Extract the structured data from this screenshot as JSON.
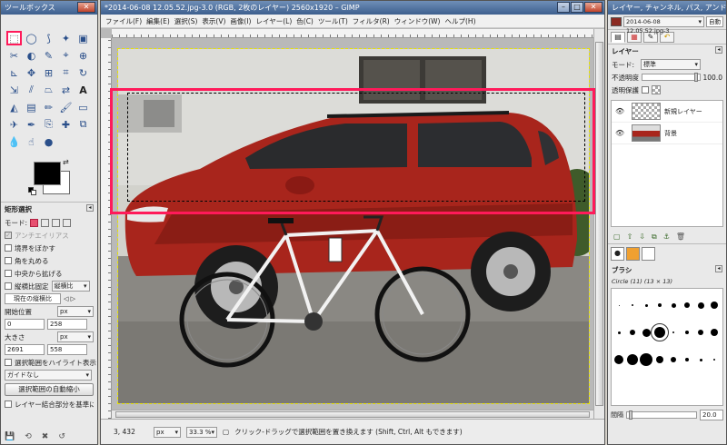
{
  "toolbox": {
    "title": "ツールボックス",
    "tool_options_title": "矩形選択",
    "mode_label": "モード:",
    "antialias_label": "アンチエイリアス",
    "feather_label": "境界をぼかす",
    "round_label": "角を丸める",
    "expand_center_label": "中央から拡げる",
    "fixed_label": "縦横比固定",
    "fixed_option": "縦横比",
    "ratio_value": "現在の縦横比",
    "position_label": "開始位置",
    "position_unit": "px",
    "position_x": "0",
    "position_y": "258",
    "size_label": "大きさ",
    "size_unit": "px",
    "size_w": "2691",
    "size_h": "558",
    "highlight_label": "選択範囲をハイライト表示",
    "guide_value": "ガイドなし",
    "autoshrink_label": "選択範囲の自動縮小",
    "merged_label": "レイヤー結合部分を基準に縮小"
  },
  "image_window": {
    "title": "*2014-06-08 12.05.52.jpg-3.0 (RGB, 2枚のレイヤー) 2560x1920 – GIMP",
    "menu": [
      "ファイル(F)",
      "編集(E)",
      "選択(S)",
      "表示(V)",
      "画像(I)",
      "レイヤー(L)",
      "色(C)",
      "ツール(T)",
      "フィルタ(R)",
      "ウィンドウ(W)",
      "ヘルプ(H)"
    ],
    "status_coords": "3, 432",
    "status_unit": "px",
    "status_zoom": "33.3 %",
    "status_message": "クリック-ドラッグで選択範囲を置き換えます (Shift, Ctrl, Alt もできます)"
  },
  "dock": {
    "title": "レイヤー, チャンネル, パス, アンドゥ...",
    "image_select": "2014-06-08 12.05.52.jpg-3",
    "auto_label": "自動",
    "layers_label": "レイヤー",
    "mode_label": "モード:",
    "mode_value": "標準",
    "opacity_label": "不透明度",
    "opacity_value": "100.0",
    "lock_label": "透明保護",
    "layers": [
      {
        "name": "新規レイヤー"
      },
      {
        "name": "背景"
      }
    ],
    "brushes_label": "ブラシ",
    "brush_name": "Circle (11) (13 × 13)",
    "spacing_label": "間隔",
    "spacing_value": "20.0"
  },
  "colors": {
    "accent": "#ff1a5a",
    "car_red": "#a8251c",
    "title_gradient_top": "#6f8fb8"
  }
}
